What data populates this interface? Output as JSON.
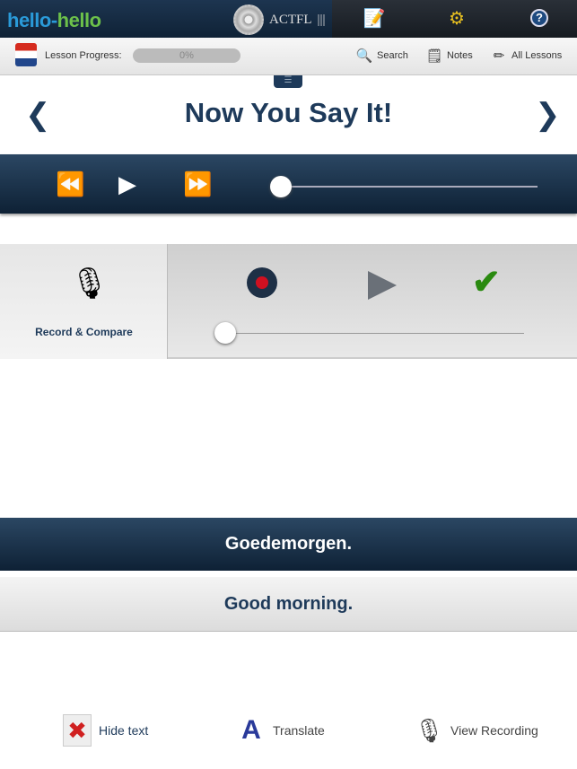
{
  "header": {
    "logo_part1": "hello-",
    "logo_part2": "hello",
    "badge": "ACTFL",
    "badge_bars": "|||"
  },
  "top_icons": [
    {
      "icon": "notebook-icon"
    },
    {
      "icon": "gears-icon"
    },
    {
      "icon": "help-icon"
    }
  ],
  "toolbar": {
    "progress_label": "Lesson Progress:",
    "progress_value": "0%",
    "progress": 0,
    "search": "Search",
    "notes": "Notes",
    "all_lessons": "All Lessons"
  },
  "title": "Now You Say It!",
  "nav": {
    "prev": "❮",
    "next": "❯"
  },
  "player": {
    "position": 0
  },
  "record": {
    "label": "Record & Compare",
    "position": 0
  },
  "phrase": {
    "target": "Goedemorgen.",
    "translation": "Good morning."
  },
  "bottom": {
    "hide_text": "Hide text",
    "translate": "Translate",
    "view_recording": "View Recording"
  },
  "colors": {
    "navy": "#1e3a5a",
    "record_red": "#d01020",
    "check_green": "#2a8a10"
  }
}
